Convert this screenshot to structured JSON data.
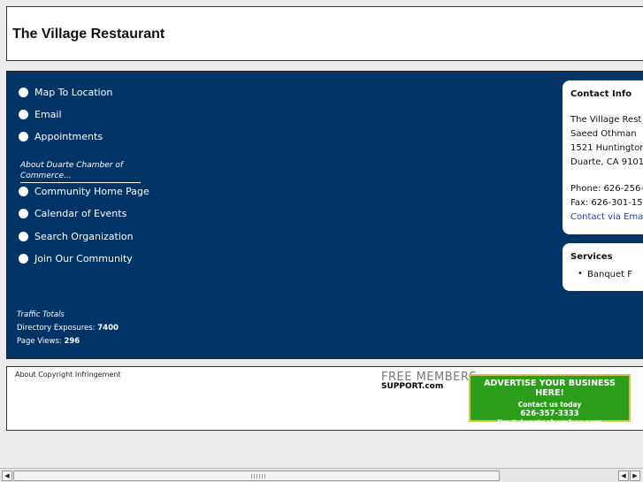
{
  "header": {
    "title": "The Village Restaurant"
  },
  "nav": {
    "top_items": [
      "Map To Location",
      "Email",
      "Appointments"
    ],
    "section_label": "About Duarte Chamber of Commerce...",
    "bottom_items": [
      "Community Home Page",
      "Calendar of Events",
      "Search Organization",
      "Join Our Community"
    ]
  },
  "traffic": {
    "heading": "Traffic Totals",
    "exposures_label": "Directory Exposures:",
    "exposures_value": "7400",
    "views_label": "Page Views:",
    "views_value": "296"
  },
  "contact": {
    "title": "Contact Info",
    "lines": [
      "The Village Rest",
      "Saeed Othman",
      "1521 Huntington",
      "Duarte, CA 9101"
    ],
    "phone": "Phone: 626-256-",
    "fax": "Fax: 626-301-15",
    "email_link": "Contact via Ema"
  },
  "services": {
    "title": "Services",
    "items": [
      "Banquet F"
    ]
  },
  "footer": {
    "copyright_link": "About Copyright Infringement",
    "free_members": "FREE MEMBERS",
    "support": "SUPPORT.com",
    "ad": {
      "line1": "ADVERTISE YOUR BUSINESS HERE!",
      "line2": "Contact us today",
      "line3": "626-357-3333",
      "line4": "jim@duartechamber.com"
    }
  },
  "scrollbar": {
    "left_arrow": "◀",
    "right_arrow": "▶"
  },
  "colors": {
    "main_bg": "#003366",
    "ad_bg": "#2d9e1b",
    "link": "#1a3fcc"
  }
}
